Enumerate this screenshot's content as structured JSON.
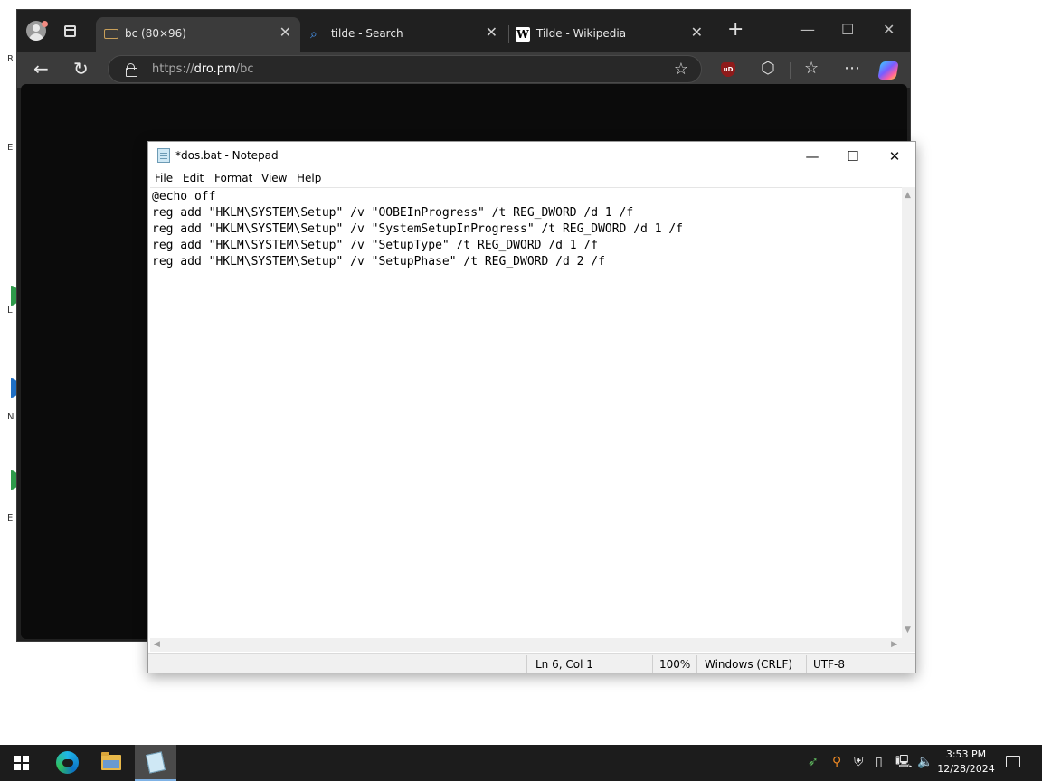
{
  "desktop": {
    "fragments": [
      "R",
      "E",
      "L",
      "N",
      "E"
    ]
  },
  "browser": {
    "tabs": [
      {
        "label": "bc (80×96)",
        "icon": "folder-icon",
        "active": true
      },
      {
        "label": "tilde - Search",
        "icon": "search-icon",
        "active": false
      },
      {
        "label": "Tilde - Wikipedia",
        "icon": "wikipedia-icon",
        "active": false
      }
    ],
    "wiki_glyph": "W",
    "url": {
      "scheme": "https://",
      "host": "dro.pm",
      "path": "/bc"
    },
    "ublock_label": "uD"
  },
  "notepad": {
    "title": "*dos.bat - Notepad",
    "menu": [
      "File",
      "Edit",
      "Format",
      "View",
      "Help"
    ],
    "content": "@echo off\nreg add \"HKLM\\SYSTEM\\Setup\" /v \"OOBEInProgress\" /t REG_DWORD /d 1 /f\nreg add \"HKLM\\SYSTEM\\Setup\" /v \"SystemSetupInProgress\" /t REG_DWORD /d 1 /f\nreg add \"HKLM\\SYSTEM\\Setup\" /v \"SetupType\" /t REG_DWORD /d 1 /f\nreg add \"HKLM\\SYSTEM\\Setup\" /v \"SetupPhase\" /t REG_DWORD /d 2 /f",
    "status": {
      "position": "Ln 6, Col 1",
      "zoom": "100%",
      "line_ending": "Windows (CRLF)",
      "encoding": "UTF-8"
    }
  },
  "taskbar": {
    "time": "3:53 PM",
    "date": "12/28/2024"
  },
  "colors": {
    "browser_frame": "#202020",
    "browser_toolbar": "#3b3b3b",
    "page_background": "#0b0b0b",
    "taskbar": "#1c1c1c",
    "accent": "#7fb2e5"
  }
}
